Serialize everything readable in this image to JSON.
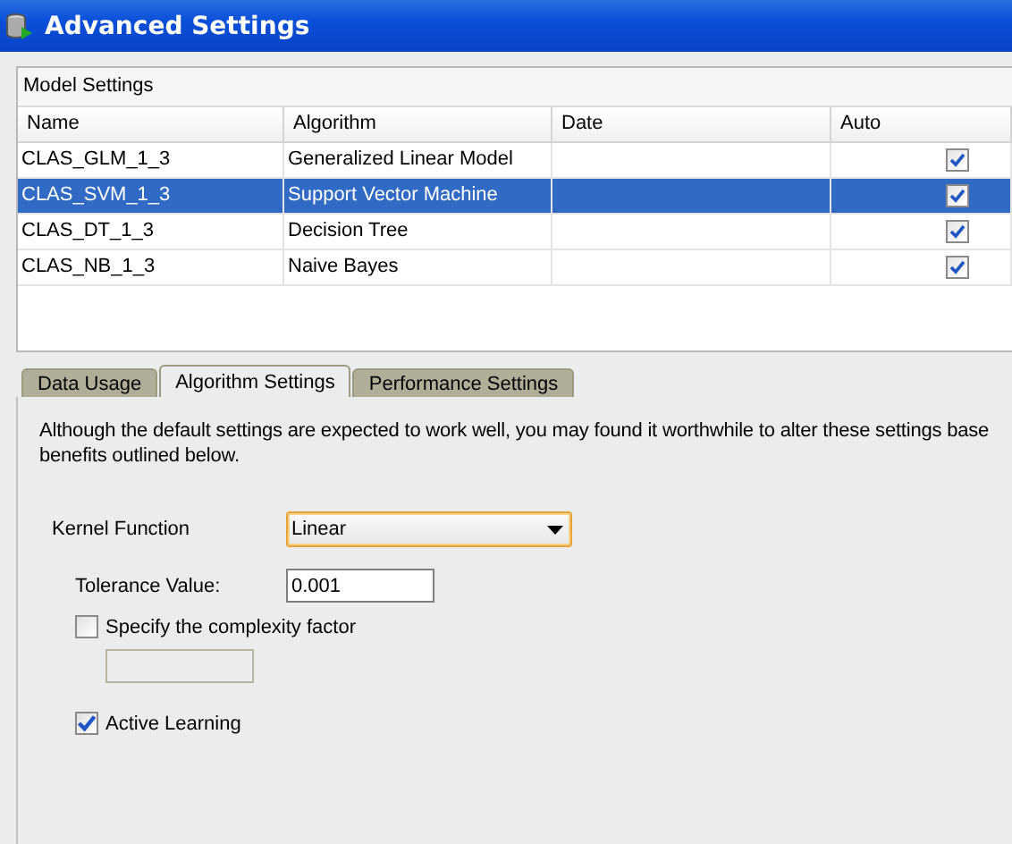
{
  "window": {
    "title": "Advanced Settings"
  },
  "model_settings": {
    "title": "Model Settings",
    "columns": [
      "Name",
      "Algorithm",
      "Date",
      "Auto"
    ],
    "rows": [
      {
        "name": "CLAS_GLM_1_3",
        "algorithm": "Generalized Linear Model",
        "auto": true,
        "selected": false
      },
      {
        "name": "CLAS_SVM_1_3",
        "algorithm": "Support Vector Machine",
        "auto": true,
        "selected": true
      },
      {
        "name": "CLAS_DT_1_3",
        "algorithm": "Decision Tree",
        "auto": true,
        "selected": false
      },
      {
        "name": "CLAS_NB_1_3",
        "algorithm": "Naive Bayes",
        "auto": true,
        "selected": false
      }
    ]
  },
  "tabs": [
    {
      "label": "Data Usage",
      "selected": false
    },
    {
      "label": "Algorithm Settings",
      "selected": true
    },
    {
      "label": "Performance Settings",
      "selected": false
    }
  ],
  "description": [
    "Although the default settings are expected to work well, you may found it worthwhile to alter these settings base",
    "benefits outlined below."
  ],
  "kernel_function": {
    "label": "Kernel Function",
    "value": "Linear"
  },
  "tolerance": {
    "label": "Tolerance Value:",
    "value": "0.001"
  },
  "complexity": {
    "label": "Specify the complexity factor",
    "checked": false
  },
  "active_learning": {
    "label": "Active Learning",
    "checked": true
  }
}
